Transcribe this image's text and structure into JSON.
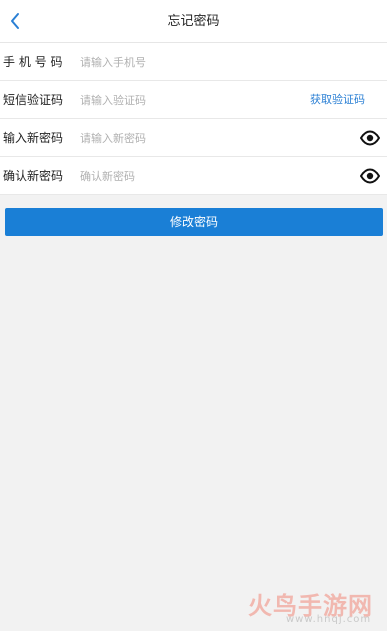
{
  "navbar": {
    "title": "忘记密码",
    "back_icon": "chevron-left-icon"
  },
  "form": {
    "phone": {
      "label": "手 机 号 码",
      "placeholder": "请输入手机号"
    },
    "sms_code": {
      "label": "短信验证码",
      "placeholder": "请输入验证码",
      "get_code_label": "获取验证码"
    },
    "new_password": {
      "label": "输入新密码",
      "placeholder": "请输入新密码",
      "eye_icon": "eye-icon"
    },
    "confirm_password": {
      "label": "确认新密码",
      "placeholder": "确认新密码",
      "eye_icon": "eye-icon"
    }
  },
  "submit_button": {
    "label": "修改密码"
  },
  "watermark": {
    "main": "火鸟手游网",
    "sub": "www.hnqj.com"
  },
  "colors": {
    "accent": "#1a7fd6",
    "link": "#2a7fd4",
    "background": "#f2f2f2"
  }
}
